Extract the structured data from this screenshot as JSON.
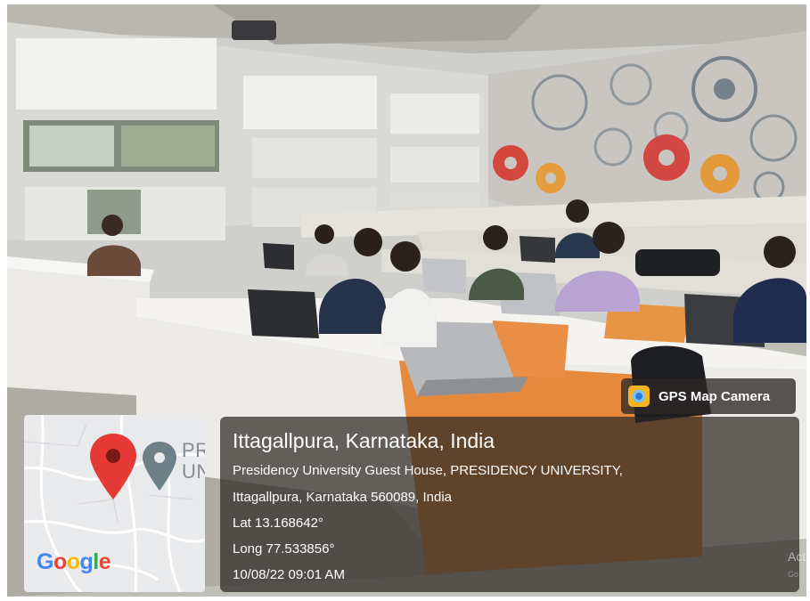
{
  "overlay": {
    "app_badge": "GPS Map Camera",
    "location_title": "Ittagallpura, Karnataka, India",
    "address_line_1": "Presidency University Guest House, PRESIDENCY UNIVERSITY,",
    "address_line_2": "Ittagallpura, Karnataka 560089, India",
    "latitude": "Lat 13.168642°",
    "longitude": "Long 77.533856°",
    "datetime": "10/08/22 09:01 AM"
  },
  "map": {
    "logo": "Google",
    "label_fragment": "PR\nUN"
  },
  "watermark": {
    "text": "Act",
    "subtext": "Go"
  },
  "colors": {
    "pin_red": "#e53935",
    "pin_gray": "#6e8088",
    "card_bg": "#2d2826"
  }
}
